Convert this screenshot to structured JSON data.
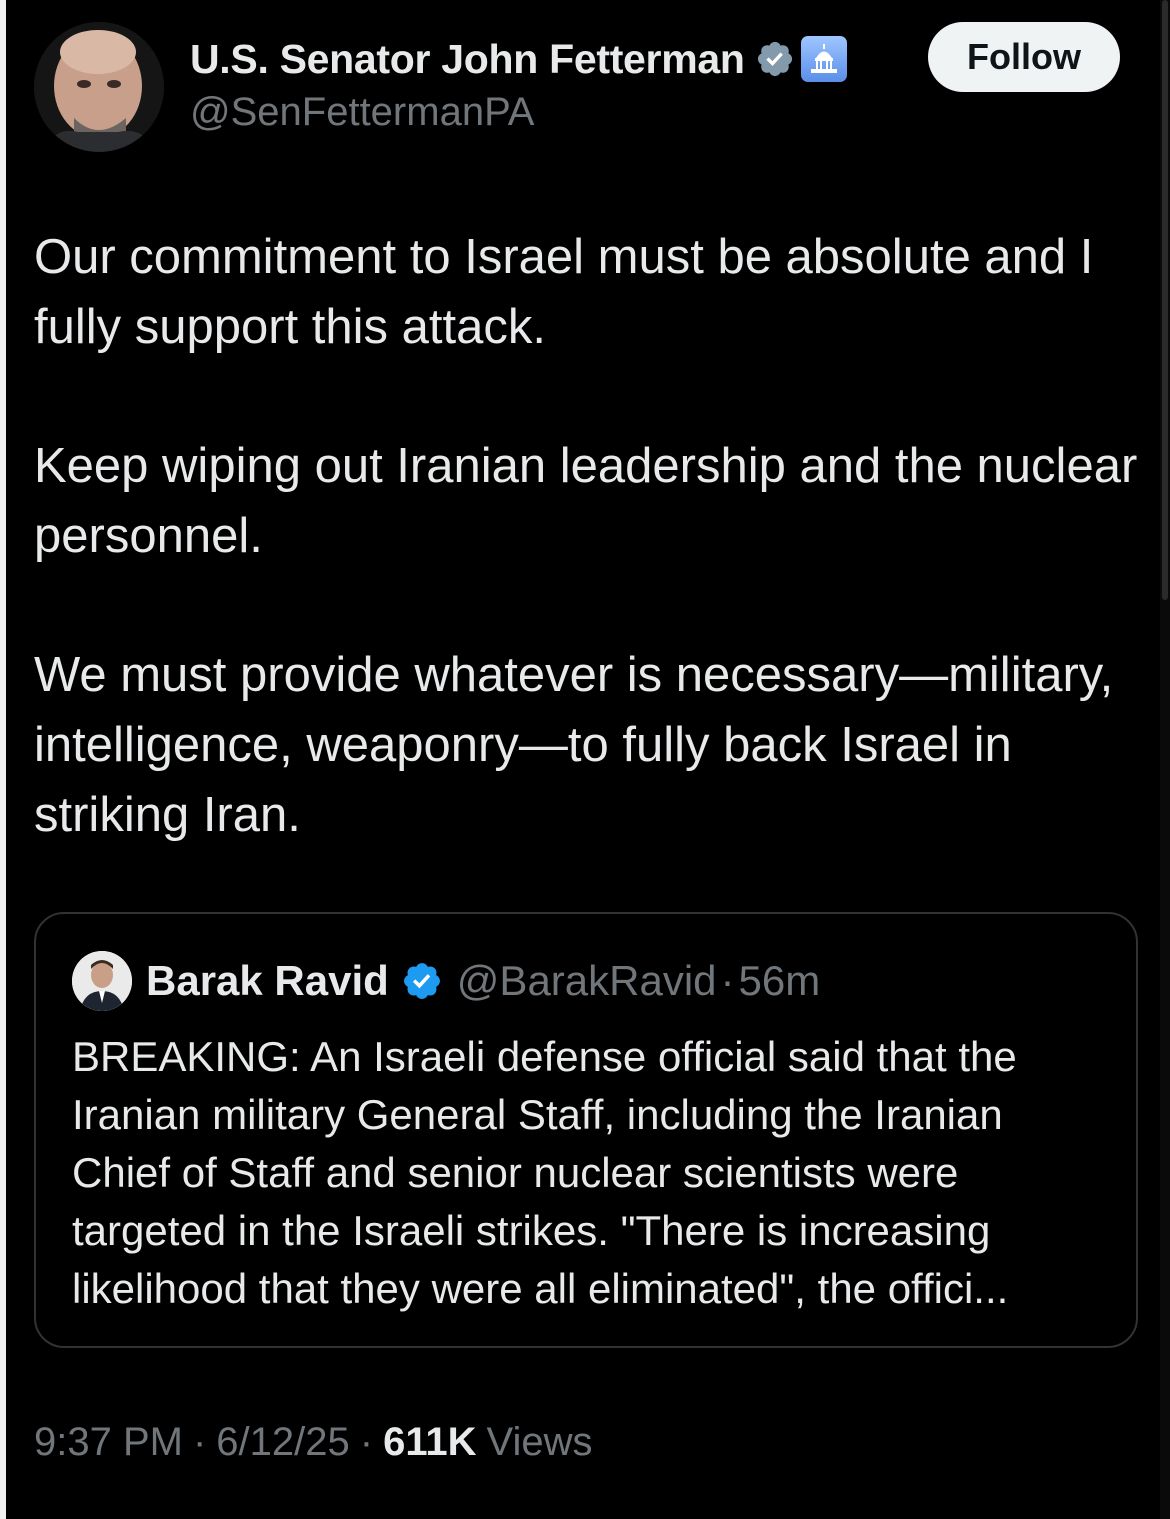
{
  "author": {
    "display_name": "U.S. Senator John Fetterman",
    "handle": "@SenFettermanPA",
    "badge_icon": "verified-gray-badge-icon",
    "affiliation_icon": "us-capitol-icon"
  },
  "follow_button": {
    "label": "Follow"
  },
  "tweet": {
    "paragraphs": [
      "Our commitment to Israel must be absolute and I fully support this attack.",
      "Keep wiping out Iranian leadership and the nuclear personnel.",
      "We must provide whatever is necessary—military, intelligence, weaponry—to fully back Israel in striking Iran."
    ]
  },
  "quoted_tweet": {
    "display_name": "Barak Ravid",
    "badge_icon": "verified-blue-badge-icon",
    "handle": "@BarakRavid",
    "separator": "·",
    "time": "56m",
    "text": "BREAKING: An Israeli defense official said that the Iranian military General Staff, including the Iranian Chief of Staff and senior nuclear scientists were targeted in the Israeli strikes. \"There is increasing likelihood that they were all eliminated\", the offici..."
  },
  "meta": {
    "time": "9:37 PM",
    "date": "6/12/25",
    "separator": "·",
    "views_count": "611K",
    "views_label": "Views"
  },
  "colors": {
    "background": "#000000",
    "primary_text": "#e7e9ea",
    "secondary_text": "#71767b",
    "verified_blue": "#1d9bf0",
    "verified_gray": "#829aab",
    "border": "#2f3336"
  }
}
